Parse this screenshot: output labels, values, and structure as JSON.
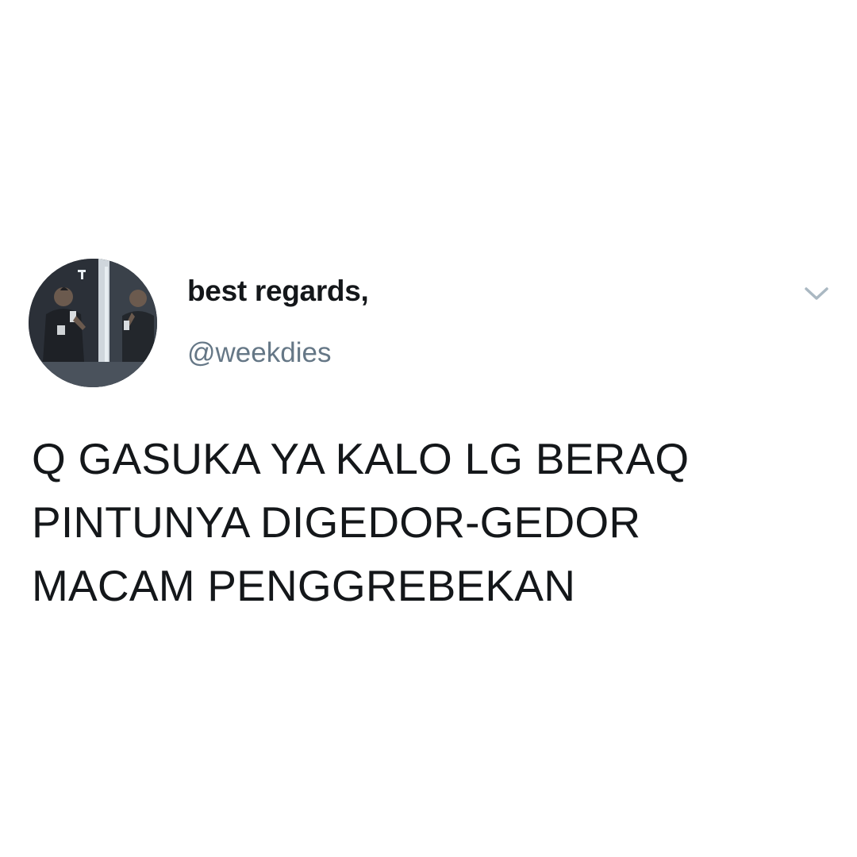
{
  "tweet": {
    "author": {
      "display_name": "best regards,",
      "handle": "@weekdies",
      "avatar_icon": "profile-photo"
    },
    "menu_icon": "chevron-down-icon",
    "text_lines": [
      "Q GASUKA YA KALO LG BERAQ",
      "PINTUNYA DIGEDOR-GEDOR",
      "MACAM PENGGREBEKAN"
    ]
  },
  "colors": {
    "background": "#ffffff",
    "text_primary": "#14171a",
    "text_secondary": "#657786",
    "caret": "#aab8c2"
  }
}
